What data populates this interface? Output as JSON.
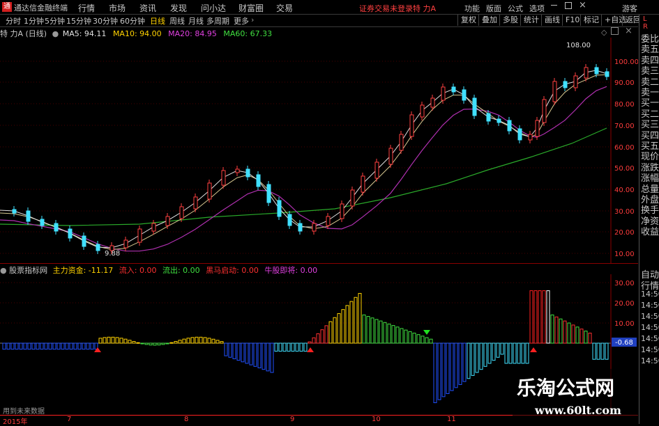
{
  "app_title": "通达信金融终端",
  "menu": [
    "行情",
    "市场",
    "资讯",
    "发现",
    "问小达",
    "财富圈",
    "交易"
  ],
  "status_text": "证券交易未登录",
  "stock_name": "特 力A",
  "menu_right": [
    "功能",
    "版面",
    "公式",
    "选项"
  ],
  "guest": "游客",
  "periods": [
    "分时",
    "1分钟",
    "5分钟",
    "15分钟",
    "30分钟",
    "60分钟",
    "日线",
    "周线",
    "月线",
    "多周期",
    "更多"
  ],
  "active_period": "日线",
  "toolbar_right": [
    "复权",
    "叠加",
    "多股",
    "统计",
    "画线",
    "F10",
    "标记",
    "+自选",
    "返回"
  ],
  "main": {
    "title": "特 力A (日线)",
    "ma": [
      {
        "label": "MA5: 94.11",
        "color": "#e0e0e0"
      },
      {
        "label": "MA10: 94.00",
        "color": "#ffd200"
      },
      {
        "label": "MA20: 84.95",
        "color": "#e040e0"
      },
      {
        "label": "MA60: 67.33",
        "color": "#40e040"
      }
    ],
    "y_ticks": [
      "100.00",
      "90.00",
      "80.00",
      "70.00",
      "60.00",
      "50.00",
      "40.00",
      "30.00",
      "20.00",
      "10.00"
    ],
    "high_label": "108.00",
    "low_label": "9.88"
  },
  "indicator": {
    "title": "股票指标网",
    "items": [
      {
        "label": "主力资金: -11.17",
        "color": "#ffd200"
      },
      {
        "label": "流入: 0.00",
        "color": "#ff3030"
      },
      {
        "label": "流出: 0.00",
        "color": "#40e040"
      },
      {
        "label": "黑马启动: 0.00",
        "color": "#ff3030"
      },
      {
        "label": "牛股即将: 0.00",
        "color": "#e040e0"
      }
    ],
    "y_ticks": [
      "30.00",
      "20.00",
      "10.00"
    ],
    "current": "-0.68",
    "note": "用到未来数据"
  },
  "dates": [
    "2015年",
    "7",
    "8",
    "9",
    "10",
    "11"
  ],
  "sidebar": {
    "letters": [
      "L",
      "R"
    ],
    "items": [
      "委比",
      "卖五",
      "卖四",
      "卖三",
      "卖二",
      "卖一",
      "买一",
      "买二",
      "买三",
      "买四",
      "买五",
      "现价",
      "涨跌",
      "涨幅",
      "总量",
      "外盘",
      "换手",
      "净资",
      "收益"
    ],
    "sub_items": [
      "自动",
      "行情",
      "14:50",
      "14:50",
      "14:50",
      "14:50",
      "14:50",
      "14:50",
      "14:50"
    ]
  },
  "watermark": {
    "title": "乐淘公式网",
    "url": "www.60lt.com"
  }
}
